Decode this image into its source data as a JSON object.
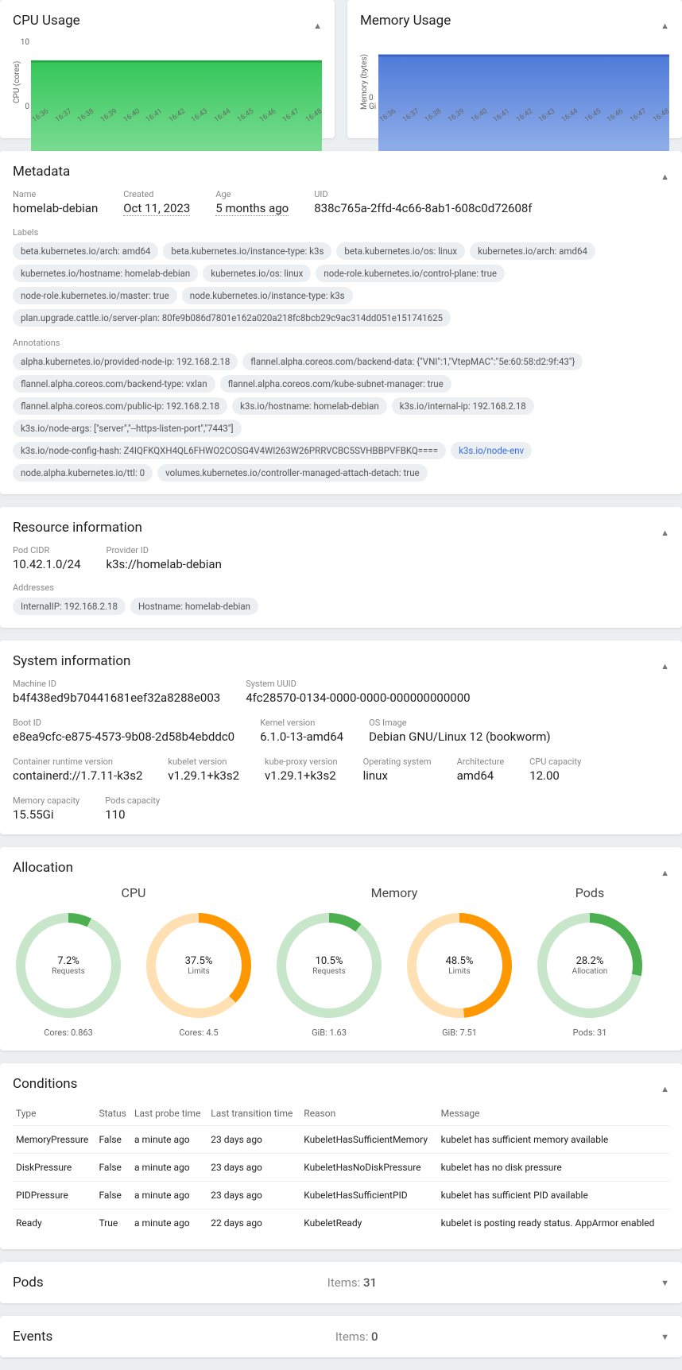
{
  "cpu_chart": {
    "title": "CPU Usage",
    "ylabel": "CPU (cores)",
    "ymax": "10",
    "ymin": "0",
    "xticks": [
      "16:36",
      "16:37",
      "16:38",
      "16:39",
      "16:40",
      "16:41",
      "16:42",
      "16:43",
      "16:44",
      "16:45",
      "16:46",
      "16:47",
      "16:48"
    ],
    "color1": "#34c759",
    "color2": "#a9e9b9"
  },
  "mem_chart": {
    "title": "Memory Usage",
    "ylabel": "Memory (bytes)",
    "ymin": "0 Gi",
    "xticks": [
      "16:36",
      "16:37",
      "16:38",
      "16:39",
      "16:40",
      "16:41",
      "16:42",
      "16:43",
      "16:44",
      "16:45",
      "16:46",
      "16:47",
      "16:48"
    ],
    "color1": "#4f7bd9",
    "color2": "#b9cef2"
  },
  "metadata": {
    "title": "Metadata",
    "name_label": "Name",
    "name": "homelab-debian",
    "created_label": "Created",
    "created": "Oct 11, 2023",
    "age_label": "Age",
    "age": "5 months ago",
    "uid_label": "UID",
    "uid": "838c765a-2ffd-4c66-8ab1-608c0d72608f",
    "labels_label": "Labels",
    "labels": [
      "beta.kubernetes.io/arch: amd64",
      "beta.kubernetes.io/instance-type: k3s",
      "beta.kubernetes.io/os: linux",
      "kubernetes.io/arch: amd64",
      "kubernetes.io/hostname: homelab-debian",
      "kubernetes.io/os: linux",
      "node-role.kubernetes.io/control-plane: true",
      "node-role.kubernetes.io/master: true",
      "node.kubernetes.io/instance-type: k3s",
      "plan.upgrade.cattle.io/server-plan: 80fe9b086d7801e162a020a218fc8bcb29c9ac314dd051e151741625"
    ],
    "annotations_label": "Annotations",
    "annotations": [
      "alpha.kubernetes.io/provided-node-ip: 192.168.2.18",
      "flannel.alpha.coreos.com/backend-data: {\"VNI\":1,\"VtepMAC\":\"5e:60:58:d2:9f:43\"}",
      "flannel.alpha.coreos.com/backend-type: vxlan",
      "flannel.alpha.coreos.com/kube-subnet-manager: true",
      "flannel.alpha.coreos.com/public-ip: 192.168.2.18",
      "k3s.io/hostname: homelab-debian",
      "k3s.io/internal-ip: 192.168.2.18",
      "k3s.io/node-args: [\"server\",\"--https-listen-port\",\"7443\"]",
      "k3s.io/node-config-hash: Z4IQFKQXH4QL6FHWO2COSG4V4WI263W26PRRVCBC5SVHBBPVFBKQ====",
      "k3s.io/node-env",
      "node.alpha.kubernetes.io/ttl: 0",
      "volumes.kubernetes.io/controller-managed-attach-detach: true"
    ],
    "annotation_link_index": 9
  },
  "resource": {
    "title": "Resource information",
    "podcidr_label": "Pod CIDR",
    "podcidr": "10.42.1.0/24",
    "provider_label": "Provider ID",
    "provider": "k3s://homelab-debian",
    "addresses_label": "Addresses",
    "addresses": [
      "InternalIP: 192.168.2.18",
      "Hostname: homelab-debian"
    ]
  },
  "system": {
    "title": "System information",
    "fields": [
      {
        "label": "Machine ID",
        "value": "b4f438ed9b70441681eef32a8288e003"
      },
      {
        "label": "System UUID",
        "value": "4fc28570-0134-0000-0000-000000000000"
      },
      {
        "label": "Boot ID",
        "value": "e8ea9cfc-e875-4573-9b08-2d58b4ebddc0"
      },
      {
        "label": "Kernel version",
        "value": "6.1.0-13-amd64"
      },
      {
        "label": "OS Image",
        "value": "Debian GNU/Linux 12 (bookworm)"
      },
      {
        "label": "Container runtime version",
        "value": "containerd://1.7.11-k3s2"
      },
      {
        "label": "kubelet version",
        "value": "v1.29.1+k3s2"
      },
      {
        "label": "kube-proxy version",
        "value": "v1.29.1+k3s2"
      },
      {
        "label": "Operating system",
        "value": "linux"
      },
      {
        "label": "Architecture",
        "value": "amd64"
      },
      {
        "label": "CPU capacity",
        "value": "12.00"
      },
      {
        "label": "Memory capacity",
        "value": "15.55Gi"
      },
      {
        "label": "Pods capacity",
        "value": "110"
      }
    ]
  },
  "allocation": {
    "title": "Allocation",
    "groups": [
      {
        "title": "CPU",
        "donuts": [
          {
            "pct": 7.2,
            "pct_label": "7.2%",
            "label": "Requests",
            "sub": "Cores: 0.863",
            "color": "#4caf50",
            "bg": "#c8e6c9"
          },
          {
            "pct": 37.5,
            "pct_label": "37.5%",
            "label": "Limits",
            "sub": "Cores: 4.5",
            "color": "#ff9800",
            "bg": "#ffe0b2"
          }
        ]
      },
      {
        "title": "Memory",
        "donuts": [
          {
            "pct": 10.5,
            "pct_label": "10.5%",
            "label": "Requests",
            "sub": "GiB: 1.63",
            "color": "#4caf50",
            "bg": "#c8e6c9"
          },
          {
            "pct": 48.5,
            "pct_label": "48.5%",
            "label": "Limits",
            "sub": "GiB: 7.51",
            "color": "#ff9800",
            "bg": "#ffe0b2"
          }
        ]
      },
      {
        "title": "Pods",
        "donuts": [
          {
            "pct": 28.2,
            "pct_label": "28.2%",
            "label": "Allocation",
            "sub": "Pods: 31",
            "color": "#4caf50",
            "bg": "#c8e6c9"
          }
        ]
      }
    ]
  },
  "conditions": {
    "title": "Conditions",
    "headers": [
      "Type",
      "Status",
      "Last probe time",
      "Last transition time",
      "Reason",
      "Message"
    ],
    "rows": [
      [
        "MemoryPressure",
        "False",
        "a minute ago",
        "23 days ago",
        "KubeletHasSufficientMemory",
        "kubelet has sufficient memory available"
      ],
      [
        "DiskPressure",
        "False",
        "a minute ago",
        "23 days ago",
        "KubeletHasNoDiskPressure",
        "kubelet has no disk pressure"
      ],
      [
        "PIDPressure",
        "False",
        "a minute ago",
        "23 days ago",
        "KubeletHasSufficientPID",
        "kubelet has sufficient PID available"
      ],
      [
        "Ready",
        "True",
        "a minute ago",
        "22 days ago",
        "KubeletReady",
        "kubelet is posting ready status. AppArmor enabled"
      ]
    ]
  },
  "pods": {
    "title": "Pods",
    "items_label": "Items:",
    "count": "31"
  },
  "events": {
    "title": "Events",
    "items_label": "Items:",
    "count": "0"
  },
  "chart_data": [
    {
      "type": "area",
      "title": "CPU Usage",
      "ylabel": "CPU (cores)",
      "ylim": [
        0,
        12
      ],
      "x": [
        "16:36",
        "16:37",
        "16:38",
        "16:39",
        "16:40",
        "16:41",
        "16:42",
        "16:43",
        "16:44",
        "16:45",
        "16:46",
        "16:47",
        "16:48"
      ],
      "series": [
        {
          "name": "CPU",
          "values": [
            10,
            10,
            10,
            10,
            10,
            10,
            10,
            10,
            10,
            10,
            10,
            10,
            10
          ]
        }
      ]
    },
    {
      "type": "area",
      "title": "Memory Usage",
      "ylabel": "Memory (bytes)",
      "ylim": [
        0,
        null
      ],
      "x": [
        "16:36",
        "16:37",
        "16:38",
        "16:39",
        "16:40",
        "16:41",
        "16:42",
        "16:43",
        "16:44",
        "16:45",
        "16:46",
        "16:47",
        "16:48"
      ],
      "series": [
        {
          "name": "Memory",
          "values": [
            1,
            1,
            1,
            1,
            1,
            1,
            1,
            1,
            1,
            1,
            1,
            1,
            1
          ]
        }
      ]
    }
  ]
}
